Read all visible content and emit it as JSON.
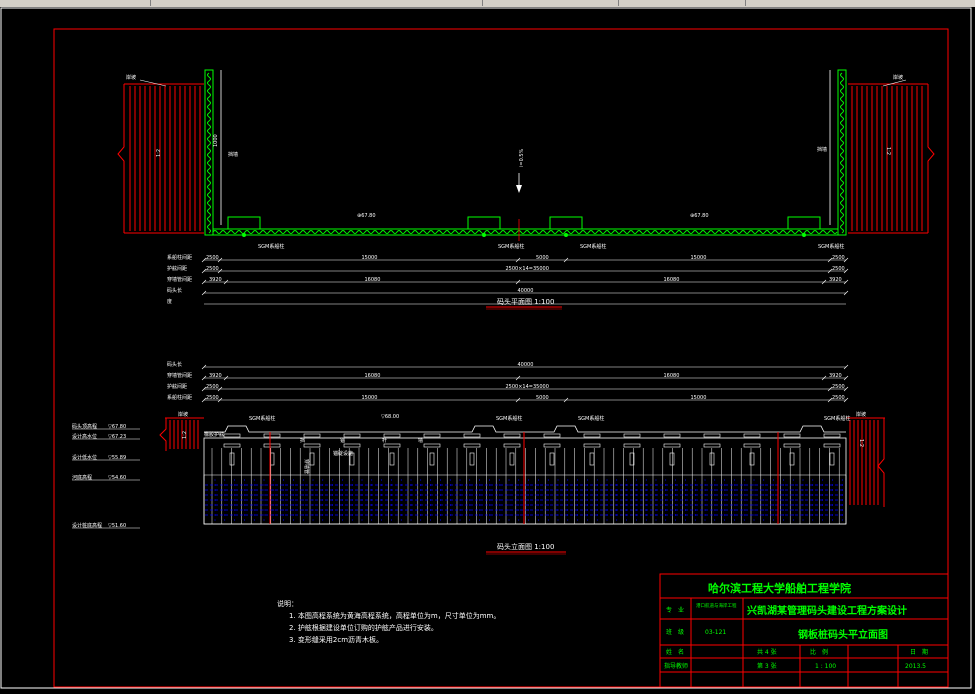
{
  "colors": {
    "frame": "#ff0000",
    "wall": "#00ff00",
    "line": "#ffffff",
    "water": "#0000ff",
    "text_green": "#00ff00"
  },
  "plan": {
    "left_bank": "岸坡",
    "right_bank": "岸坡",
    "left_slope": "1:2",
    "right_slope": "1:2",
    "wall_left": "挡墙",
    "wall_right": "挡墙",
    "vertical_dim": "1000",
    "slope_label": "i=0.5%",
    "elev_left": "67.80",
    "elev_right": "67.80",
    "piles": [
      "SGM系船柱",
      "SGM系船柱",
      "SGM系船柱",
      "SGM系船柱"
    ],
    "dim_rows": [
      {
        "label": "系船柱间距",
        "values": [
          "2500",
          "15000",
          "5000",
          "15000",
          "2500"
        ]
      },
      {
        "label": "护舷间距",
        "values": [
          "2500",
          "2500×14=35000",
          "2500"
        ]
      },
      {
        "label": "穿墙管间距",
        "values": [
          "3920",
          "16080",
          "16080",
          "3920"
        ]
      },
      {
        "label": "码头长",
        "values": [
          "40000"
        ]
      },
      {
        "label": "度",
        "values": []
      }
    ],
    "caption": "码头平面图 1:100"
  },
  "elevation": {
    "dim_rows": [
      {
        "label": "码头长",
        "values": [
          "40000"
        ]
      },
      {
        "label": "穿墙管间距",
        "values": [
          "3920",
          "16080",
          "16080",
          "3920"
        ]
      },
      {
        "label": "护舷间距",
        "values": [
          "2500",
          "2500×14=35000",
          "2500"
        ]
      },
      {
        "label": "系船柱间距",
        "values": [
          "2500",
          "15000",
          "5000",
          "15000",
          "2500"
        ]
      }
    ],
    "levels": [
      {
        "label": "码头顶高程",
        "value": "67.80"
      },
      {
        "label": "设计高水位",
        "value": "67.23"
      },
      {
        "label": "设计低水位",
        "value": "55.89"
      },
      {
        "label": "河底高程",
        "value": "54.60"
      },
      {
        "label": "设计桩底高程",
        "value": "51.60"
      }
    ],
    "bank_left": "岸坡",
    "bank_right": "岸坡",
    "slope_left": "1:2",
    "slope_right": "1:2",
    "top_elev": "68.00",
    "piles": [
      "SGM系船柱",
      "SGM系船柱",
      "SGM系船柱",
      "SGM系船柱"
    ],
    "wall_chars": [
      "挡",
      "锚",
      "杆",
      "墙"
    ],
    "fender_label": "橡胶护舷",
    "pipe_label": "穿墙管",
    "pipe_label2": "锚碇设施",
    "caption": "码头立面图 1:100"
  },
  "notes": {
    "title": "说明：",
    "items": [
      "1. 本图高程系统为黄海高程系统，高程单位为m，尺寸单位为mm。",
      "2. 护舷根据建设单位订购的护舷产品进行安装。",
      "3. 变形缝采用2cm沥青木板。"
    ]
  },
  "title_block": {
    "school": "哈尔滨工程大学船舶工程学院",
    "major_label": "专　业",
    "major_value": "港口航道与海岸工程",
    "project": "兴凯湖某管理码头建设工程方案设计",
    "class_label": "班　级",
    "class_value": "03-121",
    "drawing_name": "钢板桩码头平立面图",
    "name_label": "姓　名",
    "sheets_total": "共 4 张",
    "scale_label": "比　例",
    "date_label": "日　期",
    "advisor_label": "指导教师",
    "sheet_no": "第 3 张",
    "scale_value": "1 : 100",
    "date_value": "2013.5"
  }
}
